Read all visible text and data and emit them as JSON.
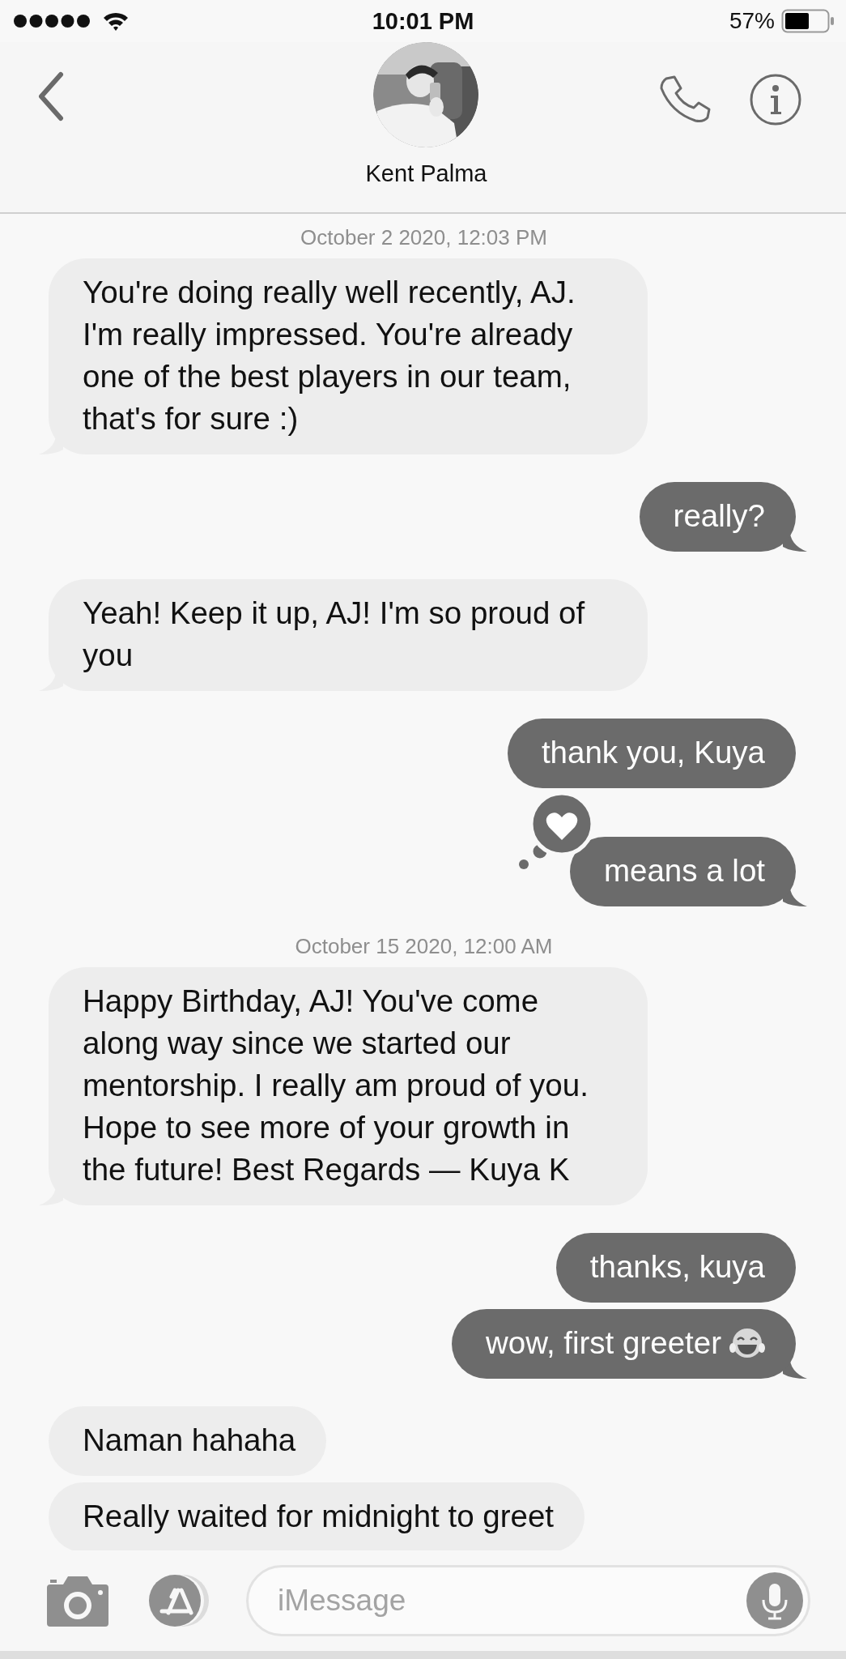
{
  "status_bar": {
    "time": "10:01 PM",
    "battery": "57%"
  },
  "header": {
    "contact_name": "Kent Palma"
  },
  "messages": [
    {
      "kind": "date",
      "text": "October 2 2020, 12:03 PM"
    },
    {
      "kind": "incoming",
      "text": "You're doing really well recently, AJ. I'm really impressed. You're already one of the best players in our team, that's for sure :)",
      "tail": true
    },
    {
      "kind": "outgoing",
      "text": "really?",
      "tail": true
    },
    {
      "kind": "incoming",
      "text": "Yeah! Keep it up, AJ! I'm so proud of you",
      "tail": true
    },
    {
      "kind": "outgoing",
      "text": "thank you, Kuya",
      "tail": false
    },
    {
      "kind": "outgoing",
      "text": "means a lot",
      "tail": true,
      "heart_reaction": true
    },
    {
      "kind": "date",
      "text": "October 15 2020, 12:00 AM"
    },
    {
      "kind": "incoming",
      "text": "Happy Birthday, AJ! You've come along way since we started our mentorship. I really am proud of you. Hope to see more of your growth in the future! Best Regards — Kuya K",
      "tail": true
    },
    {
      "kind": "outgoing",
      "text": "thanks, kuya",
      "tail": false
    },
    {
      "kind": "outgoing",
      "text": "wow, first greeter",
      "tail": true,
      "laughing_emoji": true
    },
    {
      "kind": "incoming",
      "text": "Naman hahaha",
      "tail": false
    },
    {
      "kind": "incoming",
      "text": "Really waited for midnight to greet",
      "tail": false
    }
  ],
  "compose": {
    "placeholder": "iMessage"
  }
}
